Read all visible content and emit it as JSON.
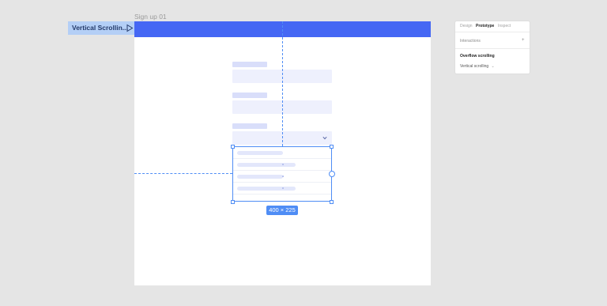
{
  "frame": {
    "label": "Sign up 01"
  },
  "flow": {
    "label": "Vertical Scrollin..."
  },
  "selection": {
    "size_label": "400 × 225"
  },
  "panel": {
    "tabs": [
      "Design",
      "Prototype",
      "Inspect"
    ],
    "active_tab": "Prototype",
    "interactions_label": "Interactions",
    "add_glyph": "+",
    "overflow_heading": "Overflow scrolling",
    "overflow_value": "Vertical scrolling",
    "overflow_chevron": "⌄"
  },
  "colors": {
    "accent": "#4f8df5",
    "header": "#4567f4",
    "flow_badge": "#b4cff6"
  }
}
